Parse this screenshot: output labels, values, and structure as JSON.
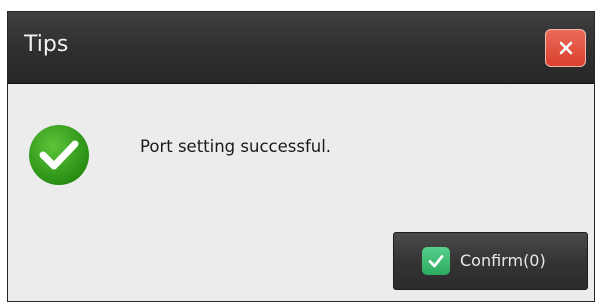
{
  "dialog": {
    "title": "Tips",
    "message": "Port setting successful.",
    "close_icon": "close-icon",
    "status_icon": "success-check-icon",
    "confirm_label": "Confirm(0)",
    "confirm_icon": "checkbox-checked-icon"
  },
  "colors": {
    "titlebar": "#2f2f2f",
    "close_button": "#e2503f",
    "success_green": "#2e9d1c",
    "confirm_check": "#3cbf74",
    "body_background": "#ececec"
  }
}
